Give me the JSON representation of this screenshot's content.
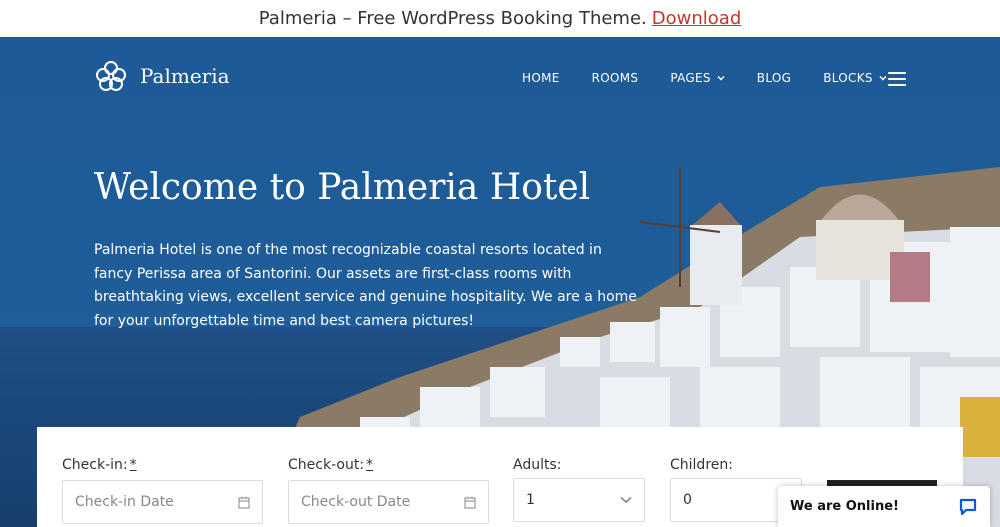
{
  "promo": {
    "text": "Palmeria – Free WordPress Booking Theme.",
    "link": "Download"
  },
  "brand": {
    "name": "Palmeria"
  },
  "nav": {
    "items": [
      {
        "label": "HOME"
      },
      {
        "label": "ROOMS"
      },
      {
        "label": "PAGES"
      },
      {
        "label": "BLOG"
      },
      {
        "label": "BLOCKS"
      }
    ]
  },
  "hero": {
    "title": "Welcome to Palmeria Hotel",
    "text": "Palmeria Hotel is one of the most recognizable coastal resorts located in fancy Perissa area of Santorini. Our assets are first-class rooms with breathtaking views, excellent service and genuine hospitality. We are a home for your unforgettable time and best camera pictures!"
  },
  "booking": {
    "checkin": {
      "label": "Check-in:",
      "required": "*",
      "placeholder": "Check-in Date"
    },
    "checkout": {
      "label": "Check-out:",
      "required": "*",
      "placeholder": "Check-out Date"
    },
    "adults": {
      "label": "Adults:",
      "value": "1"
    },
    "children": {
      "label": "Children:",
      "value": "0"
    }
  },
  "chat": {
    "status": "We are Online!"
  },
  "colors": {
    "hero_blue": "#1d5a96",
    "link_red": "#c0392b",
    "chat_icon": "#0a5ad6"
  }
}
